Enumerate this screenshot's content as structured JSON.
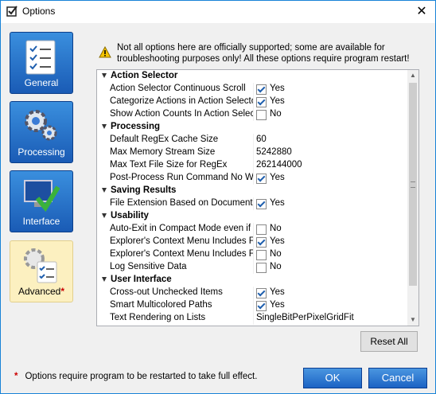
{
  "window": {
    "title": "Options"
  },
  "nav": [
    {
      "label": "General",
      "icon": "checklist-icon"
    },
    {
      "label": "Processing",
      "icon": "gears-icon"
    },
    {
      "label": "Interface",
      "icon": "monitor-check-icon"
    },
    {
      "label": "Advanced",
      "icon": "gears-checklist-icon",
      "star": "*"
    }
  ],
  "warning": "Not all options here are officially supported; some are available for troubleshooting purposes only! All these options require program restart!",
  "grid": {
    "rows": [
      {
        "type": "cat",
        "label": "Action Selector"
      },
      {
        "type": "bool",
        "name": "Action Selector Continuous Scroll",
        "checked": true,
        "value": "Yes"
      },
      {
        "type": "bool",
        "name": "Categorize Actions in Action Selector",
        "checked": true,
        "value": "Yes"
      },
      {
        "type": "bool",
        "name": "Show Action Counts In Action Selector",
        "checked": false,
        "value": "No"
      },
      {
        "type": "cat",
        "label": "Processing"
      },
      {
        "type": "text",
        "name": "Default RegEx Cache Size",
        "value": "60"
      },
      {
        "type": "text",
        "name": "Max Memory Stream Size",
        "value": "5242880"
      },
      {
        "type": "text",
        "name": "Max Text File Size for RegEx",
        "value": "262144000"
      },
      {
        "type": "bool",
        "name": "Post-Process Run Command No Window",
        "checked": true,
        "value": "Yes"
      },
      {
        "type": "cat",
        "label": "Saving Results"
      },
      {
        "type": "bool",
        "name": "File Extension Based on Document",
        "checked": true,
        "value": "Yes"
      },
      {
        "type": "cat",
        "label": "Usability"
      },
      {
        "type": "bool",
        "name": "Auto-Exit in Compact Mode even if",
        "checked": false,
        "value": "No"
      },
      {
        "type": "bool",
        "name": "Explorer's Context Menu Includes F",
        "checked": true,
        "value": "Yes"
      },
      {
        "type": "bool",
        "name": "Explorer's Context Menu Includes F",
        "checked": false,
        "value": "No"
      },
      {
        "type": "bool",
        "name": "Log Sensitive Data",
        "checked": false,
        "value": "No"
      },
      {
        "type": "cat",
        "label": "User Interface"
      },
      {
        "type": "bool",
        "name": "Cross-out Unchecked Items",
        "checked": true,
        "value": "Yes"
      },
      {
        "type": "bool",
        "name": "Smart Multicolored Paths",
        "checked": true,
        "value": "Yes"
      },
      {
        "type": "text",
        "name": "Text Rendering on Lists",
        "value": "SingleBitPerPixelGridFit"
      }
    ]
  },
  "buttons": {
    "reset": "Reset All",
    "ok": "OK",
    "cancel": "Cancel"
  },
  "footnote": {
    "star": "*",
    "text": "Options require program to be restarted to take full effect."
  },
  "colors": {
    "accent": "#1c63c4",
    "star": "#cc0000"
  }
}
